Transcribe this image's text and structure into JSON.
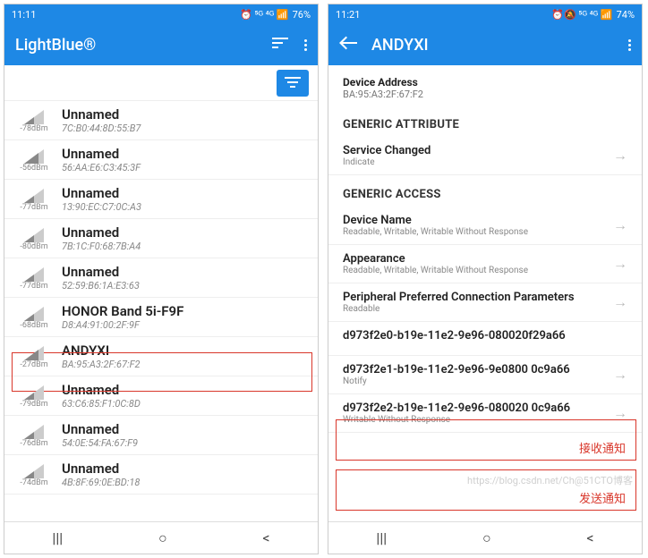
{
  "left": {
    "time": "11:11",
    "battery": "76%",
    "appTitle": "LightBlue®",
    "devices": [
      {
        "name": "Unnamed",
        "addr": "7C:B0:44:8D:55:B7",
        "dbm": "-78dBm",
        "sig": "s2"
      },
      {
        "name": "Unnamed",
        "addr": "56:AA:E6:C3:45:3F",
        "dbm": "-56dBm",
        "sig": "s3"
      },
      {
        "name": "Unnamed",
        "addr": "13:90:EC:C7:0C:A3",
        "dbm": "-77dBm",
        "sig": "s2"
      },
      {
        "name": "Unnamed",
        "addr": "7B:1C:F0:68:7B:A4",
        "dbm": "-80dBm",
        "sig": "s2"
      },
      {
        "name": "Unnamed",
        "addr": "52:59:B6:1A:E3:63",
        "dbm": "-77dBm",
        "sig": "s2"
      },
      {
        "name": "HONOR Band 5i-F9F",
        "addr": "D8:A4:91:00:2F:9F",
        "dbm": "-68dBm",
        "sig": "s2"
      },
      {
        "name": "ANDYXI",
        "addr": "BA:95:A3:2F:67:F2",
        "dbm": "-27dBm",
        "sig": "s3"
      },
      {
        "name": "Unnamed",
        "addr": "63:C6:85:F1:0C:8D",
        "dbm": "-79dBm",
        "sig": "s2"
      },
      {
        "name": "Unnamed",
        "addr": "54:0E:54:FA:67:F9",
        "dbm": "-76dBm",
        "sig": "s2"
      },
      {
        "name": "Unnamed",
        "addr": "4B:8F:69:0E:BD:18",
        "dbm": "-74dBm",
        "sig": "s2"
      }
    ]
  },
  "right": {
    "time": "11:21",
    "battery": "74%",
    "title": "ANDYXI",
    "addrLabel": "Device Address",
    "addr": "BA:95:A3:2F:67:F2",
    "sections": {
      "ga": "GENERIC ATTRIBUTE",
      "gacc": "GENERIC ACCESS"
    },
    "chars": [
      {
        "name": "Service Changed",
        "sub": "Indicate"
      },
      {
        "name": "Device Name",
        "sub": "Readable, Writable, Writable Without Response"
      },
      {
        "name": "Appearance",
        "sub": "Readable, Writable, Writable Without Response"
      },
      {
        "name": "Peripheral Preferred Connection Parameters",
        "sub": "Readable"
      },
      {
        "name": "d973f2e0-b19e-11e2-9e96-080020f29a66",
        "sub": ""
      },
      {
        "name": "d973f2e1-b19e-11e2-9e96-9e0800 0c9a66",
        "sub": "Notify"
      },
      {
        "name": "d973f2e2-b19e-11e2-9e96-080020 0c9a66",
        "sub": "Writable Without Response"
      }
    ],
    "annotations": {
      "notify": "接收通知",
      "write": "发送通知"
    }
  },
  "watermark": "https://blog.csdn.net/Ch@51CTO博客"
}
